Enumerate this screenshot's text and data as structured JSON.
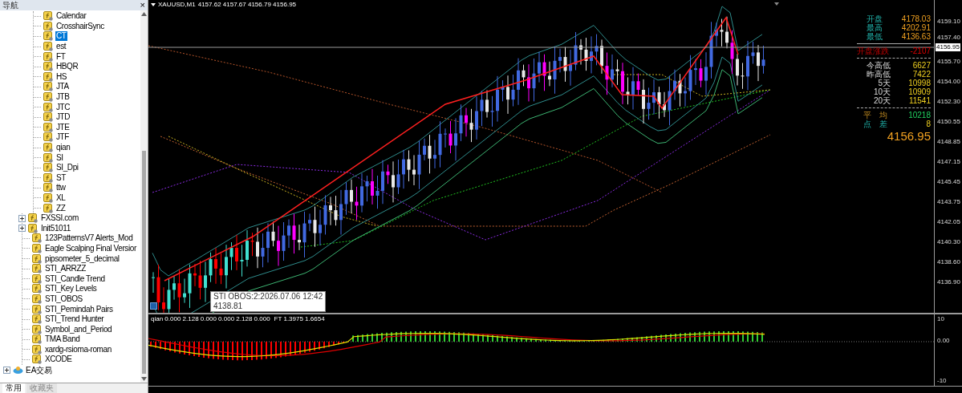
{
  "navigator": {
    "title": "导航",
    "close": "×",
    "nested_items": [
      {
        "label": "Calendar",
        "selected": false
      },
      {
        "label": "CrosshairSync",
        "selected": false
      },
      {
        "label": "CT",
        "selected": true
      },
      {
        "label": "est",
        "selected": false
      },
      {
        "label": "FT",
        "selected": false
      },
      {
        "label": "HBQR",
        "selected": false
      },
      {
        "label": "HS",
        "selected": false
      },
      {
        "label": "JTA",
        "selected": false
      },
      {
        "label": "JTB",
        "selected": false
      },
      {
        "label": "JTC",
        "selected": false
      },
      {
        "label": "JTD",
        "selected": false
      },
      {
        "label": "JTE",
        "selected": false
      },
      {
        "label": "JTF",
        "selected": false
      },
      {
        "label": "qian",
        "selected": false
      },
      {
        "label": "SI",
        "selected": false
      },
      {
        "label": "SI_Dpi",
        "selected": false
      },
      {
        "label": "ST",
        "selected": false
      },
      {
        "label": "ttw",
        "selected": false
      },
      {
        "label": "XL",
        "selected": false
      },
      {
        "label": "ZZ",
        "selected": false
      }
    ],
    "items": [
      {
        "label": "FXSSI.com",
        "selected": false,
        "expanded": false
      },
      {
        "label": "Init51011",
        "selected": false,
        "expanded": false
      },
      {
        "label": "123PatternsV7 Alerts_Mod",
        "selected": false
      },
      {
        "label": "Eagle Scalping Final Versior",
        "selected": false
      },
      {
        "label": "pipsometer_5_decimal",
        "selected": false
      },
      {
        "label": "STI_ARRZZ",
        "selected": false
      },
      {
        "label": "STI_Candle Trend",
        "selected": false
      },
      {
        "label": "STI_Key Levels",
        "selected": false
      },
      {
        "label": "STI_OBOS",
        "selected": false
      },
      {
        "label": "STI_Pemindah Pairs",
        "selected": false
      },
      {
        "label": "STI_Trend Hunter",
        "selected": false
      },
      {
        "label": "Symbol_and_Period",
        "selected": false
      },
      {
        "label": "TMA Band",
        "selected": false
      },
      {
        "label": "xardg-rsioma-roman",
        "selected": false
      },
      {
        "label": "XCODE",
        "selected": false
      }
    ],
    "ea_folder": {
      "label": "EA交易",
      "expanded": false
    },
    "tabs": [
      {
        "label": "常用",
        "selected": true
      },
      {
        "label": "收藏夹",
        "selected": false
      }
    ]
  },
  "chart": {
    "title": "XAUUSD,M1",
    "quote": "4157.62 4157.67 4156.79 4156.95",
    "info_panel": {
      "session": [
        {
          "label": "开盘",
          "value": "4178.03"
        },
        {
          "label": "最高",
          "value": "4202.91"
        },
        {
          "label": "最低",
          "value": "4136.63"
        }
      ],
      "change": {
        "label": "开盘涨跌",
        "value": "-2107"
      },
      "ranges": [
        {
          "label": "今高低",
          "value": "6627"
        },
        {
          "label": "昨高低",
          "value": "7422"
        },
        {
          "label": "5天",
          "value": "10998"
        },
        {
          "label": "10天",
          "value": "10909"
        },
        {
          "label": "20天",
          "value": "11541"
        }
      ],
      "average": {
        "label": "平　均",
        "value": "10218"
      },
      "spread": {
        "label": "点　差",
        "value": "8"
      },
      "last_price": "4156.95"
    },
    "price_axis": [
      "4159.10",
      "4157.40",
      "4155.70",
      "4154.00",
      "4152.30",
      "4150.55",
      "4148.85",
      "4147.15",
      "4145.45",
      "4143.75",
      "4142.05",
      "4140.30",
      "4138.60",
      "4136.90"
    ],
    "current_price": "4156.95",
    "tooltip": {
      "title": "STI OBOS:2:2026.07.06 12:42",
      "value": "4138.81"
    }
  },
  "indicator": {
    "label": "qian 0.000 2.128 0.000 0.000 2.128 0.000",
    "label_2": "FT 1.3975 1.6654",
    "axis": [
      "10",
      "0.00",
      "-10"
    ]
  }
}
